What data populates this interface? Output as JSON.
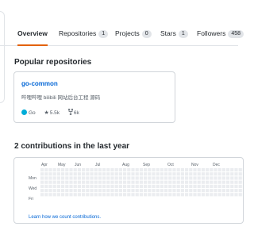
{
  "tabs": [
    {
      "label": "Overview",
      "count": ""
    },
    {
      "label": "Repositories",
      "count": "1"
    },
    {
      "label": "Projects",
      "count": "0"
    },
    {
      "label": "Stars",
      "count": "1"
    },
    {
      "label": "Followers",
      "count": "458"
    }
  ],
  "popular": {
    "title": "Popular repositories",
    "repo": {
      "name": "go-common",
      "description": "哔哩哔哩 bilibili 网站后台工程 源码",
      "language_color": "#00add8",
      "language": "Go",
      "stars": "5.5k",
      "forks": "6k"
    }
  },
  "contributions": {
    "title": "2 contributions in the last year",
    "months": [
      "Apr",
      "May",
      "Jun",
      "Jul",
      "Aug",
      "Sep",
      "Oct",
      "Nov",
      "Dec"
    ],
    "days": [
      "Mon",
      "Wed",
      "Fri"
    ],
    "learn_link": "Learn how we count contributions.",
    "empty_color": "#ebedf0"
  },
  "colors": {
    "accent": "#e36209",
    "link": "#0366d6",
    "border": "#e1e4e8"
  }
}
